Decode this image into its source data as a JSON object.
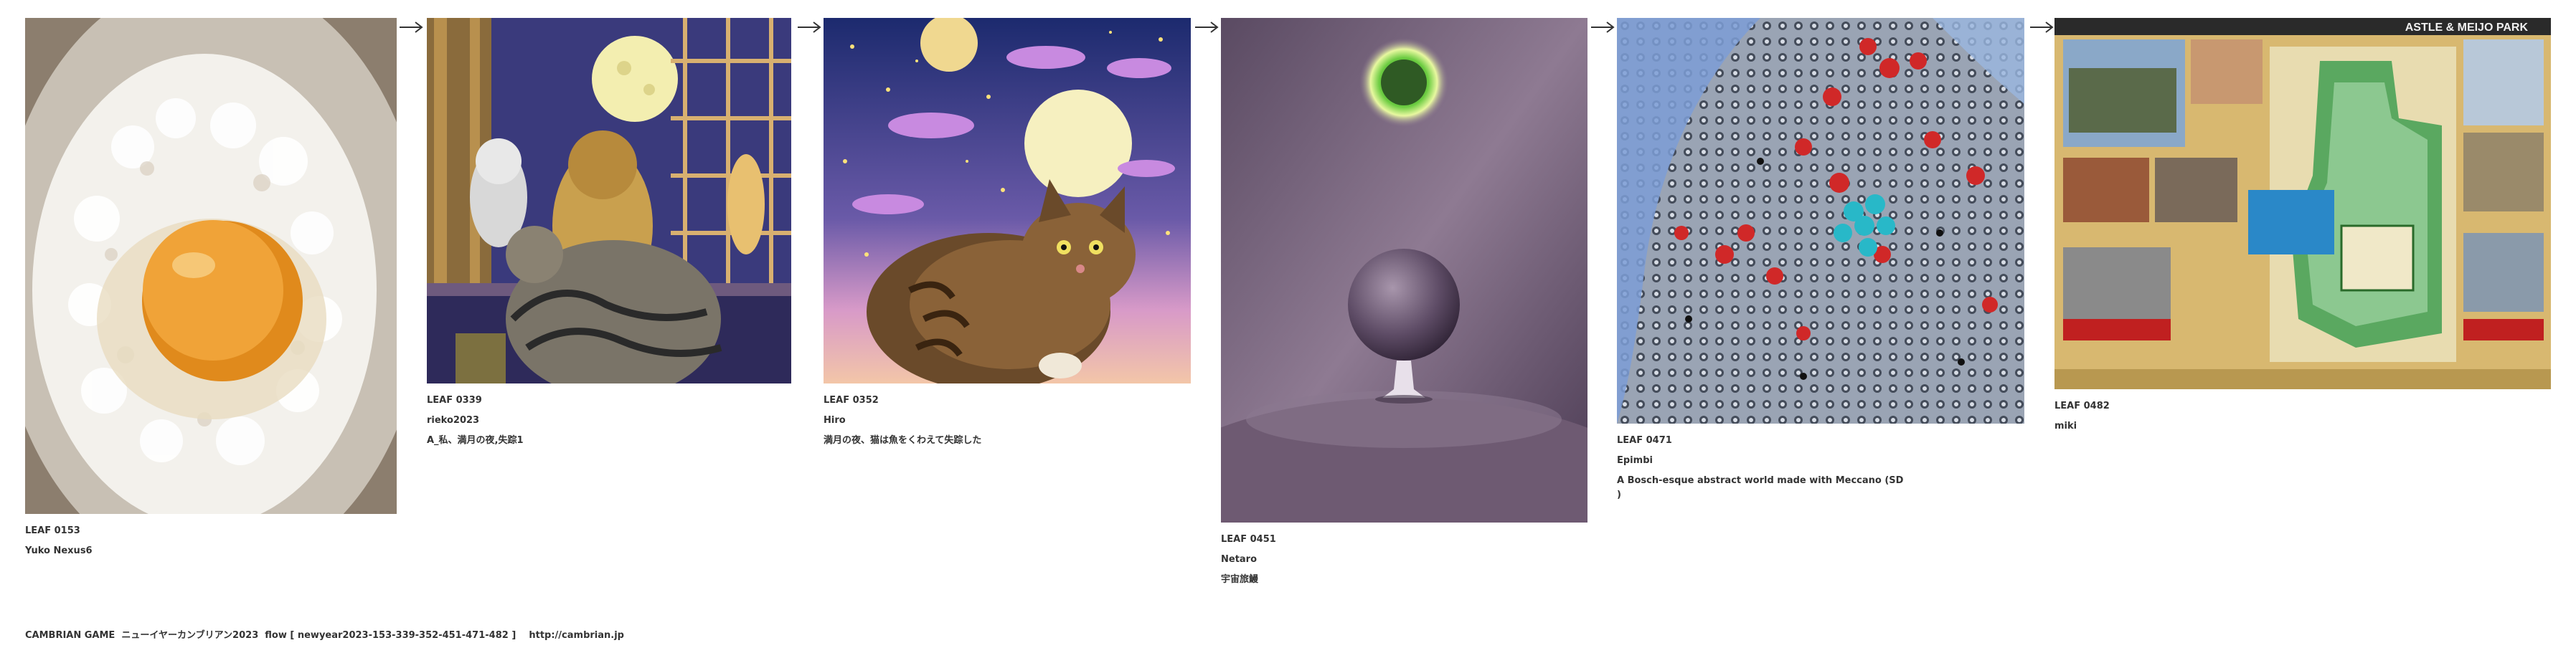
{
  "leaves": [
    {
      "code": "LEAF 0153",
      "author": "Yuko Nexus6",
      "desc": ""
    },
    {
      "code": "LEAF 0339",
      "author": "rieko2023",
      "desc": "A_私、満月の夜,失踪1"
    },
    {
      "code": "LEAF 0352",
      "author": "Hiro",
      "desc": "満月の夜、猫は魚をくわえて失踪した"
    },
    {
      "code": "LEAF 0451",
      "author": "Netaro",
      "desc": "宇宙旅鰻"
    },
    {
      "code": "LEAF 0471",
      "author": "Epimbi",
      "desc": "A Bosch-esque abstract world made with Meccano (SD\n)"
    },
    {
      "code": "LEAF 0482",
      "author": "miki",
      "desc": ""
    }
  ],
  "arrows": [
    "arrow-right-icon",
    "arrow-right-icon",
    "arrow-right-icon",
    "arrow-right-icon",
    "arrow-right-icon"
  ],
  "footer": {
    "text": "CAMBRIAN GAME  ニューイヤーカンブリアン2023  flow [ newyear2023-153-339-352-451-471-482 ]    http://cambrian.jp"
  },
  "images": {
    "map_banner": "ASTLE & MEIJO PARK"
  }
}
